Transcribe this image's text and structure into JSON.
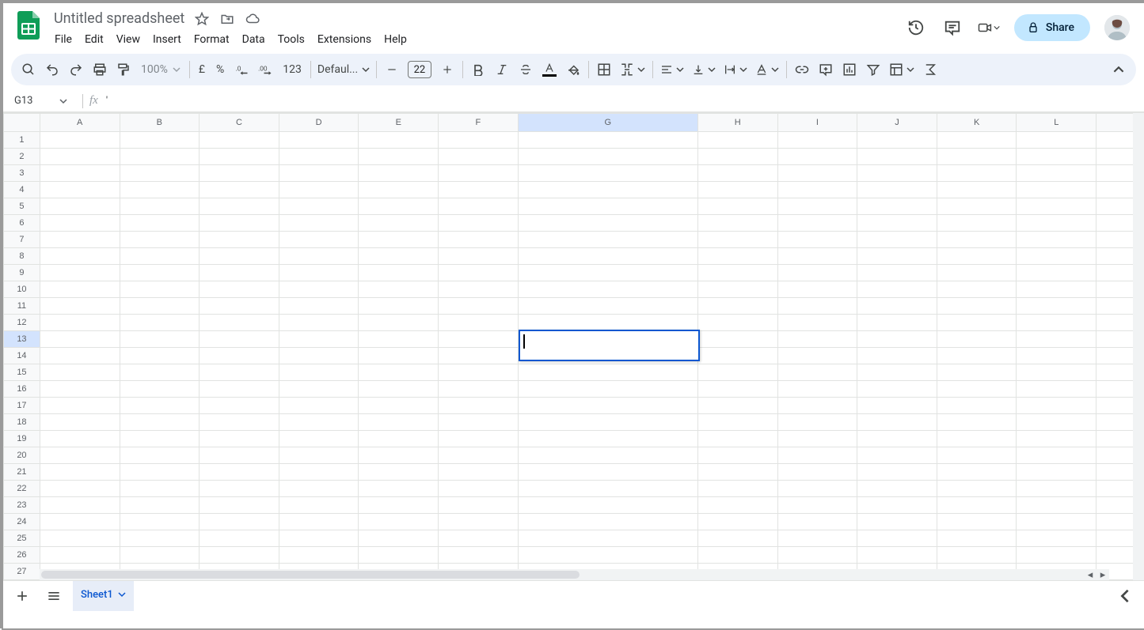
{
  "header": {
    "doc_title": "Untitled spreadsheet",
    "menus": [
      "File",
      "Edit",
      "View",
      "Insert",
      "Format",
      "Data",
      "Tools",
      "Extensions",
      "Help"
    ],
    "share_label": "Share"
  },
  "toolbar": {
    "zoom": "100%",
    "currency_symbol": "£",
    "percent_symbol": "%",
    "format_123": "123",
    "font_name": "Defaul...",
    "font_size": "22"
  },
  "formula": {
    "name_box": "G13",
    "fx_label": "fx",
    "content": "'"
  },
  "grid": {
    "columns": [
      "A",
      "B",
      "C",
      "D",
      "E",
      "F",
      "G",
      "H",
      "I",
      "J",
      "K",
      "L"
    ],
    "wide_column": "G",
    "row_count": 28,
    "selected": {
      "col": "G",
      "row": 13,
      "col_index": 7
    }
  },
  "footer": {
    "active_sheet": "Sheet1"
  }
}
